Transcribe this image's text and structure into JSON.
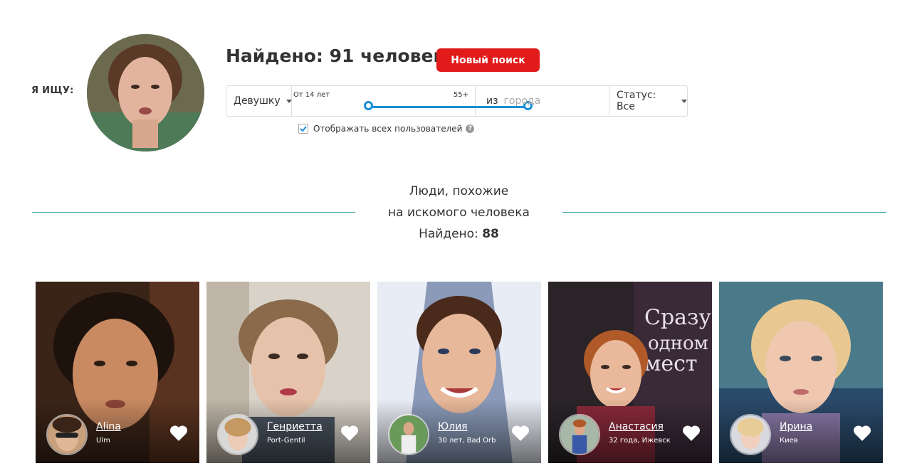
{
  "search": {
    "label": "Я ИЩУ:",
    "results_title": "Найдено: 91 человек",
    "new_search_label": "Новый поиск",
    "gender_value": "Девушку",
    "age_min_label": "От 14 лет",
    "age_max_label": "55+",
    "age_min": 14,
    "age_max": 55,
    "city_prefix": "из",
    "city_placeholder": "города",
    "status_value": "Статус: Все",
    "show_all_label": "Отображать всех пользователей",
    "show_all_checked": true,
    "help_glyph": "?"
  },
  "similar": {
    "line1": "Люди, похожие",
    "line2": "на искомого человека",
    "found_prefix": "Найдено:",
    "found_count": "88"
  },
  "profiles": [
    {
      "name": "Alina",
      "location": "Ulm"
    },
    {
      "name": "Генриетта",
      "location": "Port-Gentil"
    },
    {
      "name": "Юлия",
      "location": "30 лет, Bad Orb"
    },
    {
      "name": "Анастасия",
      "location": "32 года, Ижевск"
    },
    {
      "name": "Ирина",
      "location": "Киев"
    }
  ],
  "colors": {
    "accent_red": "#e11a1a",
    "slider_blue": "#1a8fd6",
    "divider_teal": "#37a6a6",
    "checkbox_blue": "#1a8fd6"
  },
  "icons": {
    "checkbox": "checkmark-icon",
    "help": "question-icon",
    "dropdown": "chevron-down-icon",
    "like": "heart-icon"
  }
}
